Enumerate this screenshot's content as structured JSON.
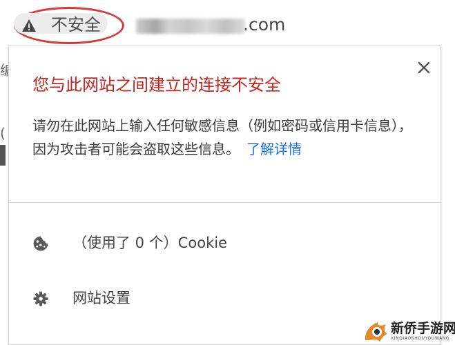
{
  "address_bar": {
    "security_label": "不安全",
    "domain_suffix": ".com"
  },
  "background": {
    "fragment_1": "编",
    "fragment_2": "(",
    "fragment_3": "√"
  },
  "popup": {
    "title": "您与此网站之间建立的连接不安全",
    "description": "请勿在此网站上输入任何敏感信息（例如密码或信用卡信息），因为攻击者可能会盗取这些信息。",
    "learn_more": "了解详情",
    "cookie_label": "（使用了 0 个）Cookie",
    "site_settings_label": "网站设置",
    "close_icon": "close-icon",
    "cookie_icon": "cookie-icon",
    "settings_icon": "gear-icon",
    "warning_icon": "warning-icon"
  },
  "watermark": {
    "brand": "新侨手游网",
    "sub": "XINQIAOSHOUYOUWANG"
  },
  "colors": {
    "title_red": "#c5251f",
    "link_blue": "#1a73e8",
    "chip_outline_red": "#d53b3b"
  }
}
